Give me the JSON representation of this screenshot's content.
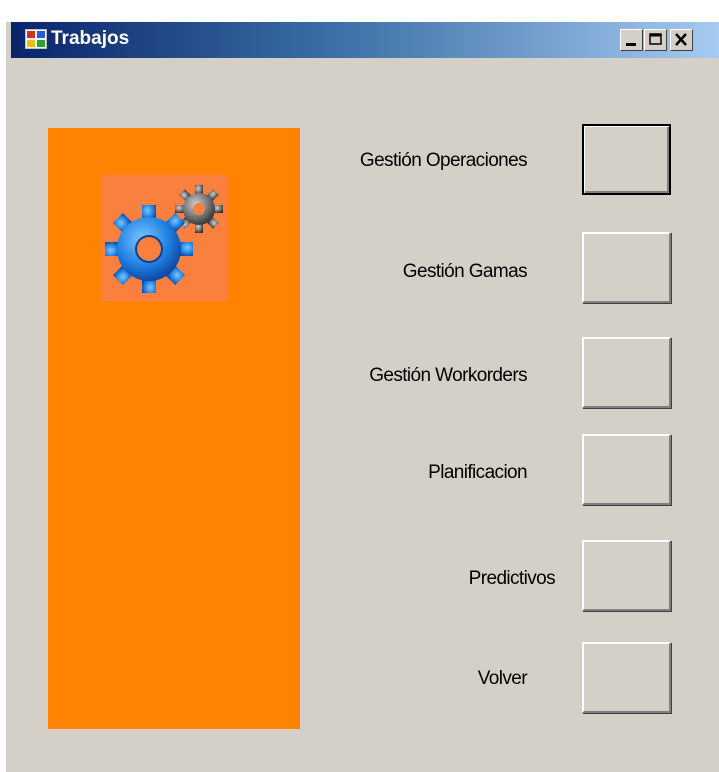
{
  "window": {
    "title": "Trabajos"
  },
  "menu": {
    "items": [
      {
        "label": "Gestión Operaciones"
      },
      {
        "label": "Gestión Gamas"
      },
      {
        "label": "Gestión Workorders"
      },
      {
        "label": "Planificacion"
      },
      {
        "label": "Predictivos"
      },
      {
        "label": "Volver"
      }
    ]
  },
  "colors": {
    "panel": "#ff8200",
    "gear_bg": "#fa8040",
    "titlebar_start": "#0a246a",
    "titlebar_end": "#a6caf0"
  },
  "icons": {
    "app": "windows-form-icon",
    "banner": "gears-icon"
  }
}
